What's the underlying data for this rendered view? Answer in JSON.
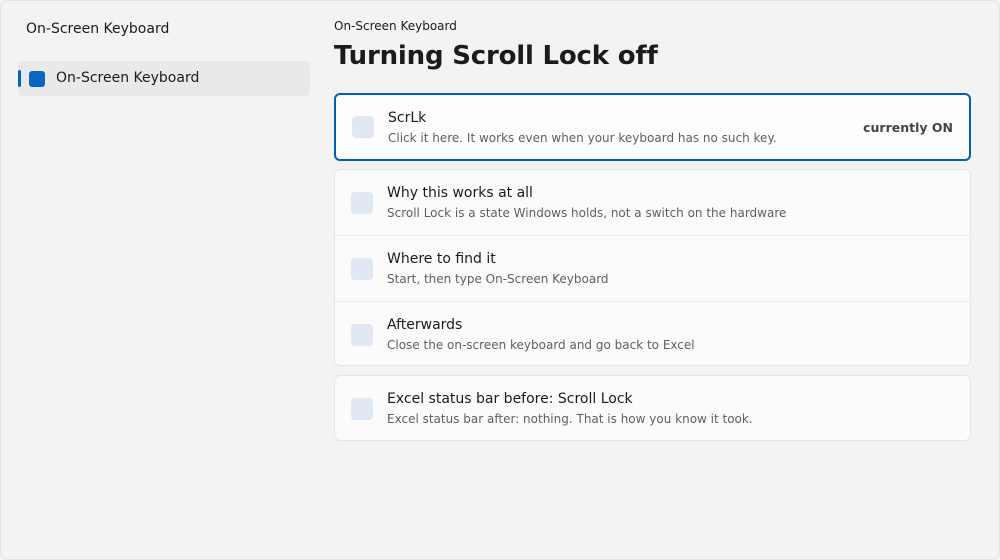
{
  "sidebar": {
    "app_title": "On-Screen Keyboard",
    "items": [
      {
        "label": "On-Screen Keyboard",
        "selected": true,
        "icon": "keyboard-app-icon"
      }
    ]
  },
  "main": {
    "breadcrumb": "On-Screen Keyboard",
    "title": "Turning Scroll Lock off",
    "action_card": {
      "title": "ScrLk",
      "description": "Click it here. It works even when your keyboard has no such key.",
      "status": "currently ON"
    },
    "info_rows": [
      {
        "title": "Why this works at all",
        "description": "Scroll Lock is a state Windows holds, not a switch on the hardware"
      },
      {
        "title": "Where to find it",
        "description": "Start, then type On-Screen Keyboard"
      },
      {
        "title": "Afterwards",
        "description": "Close the on-screen keyboard and go back to Excel"
      }
    ],
    "status_card": {
      "title": "Excel status bar before: Scroll Lock",
      "description": "Excel status bar after: nothing. That is how you know it took."
    }
  },
  "colors": {
    "accent": "#005fb8",
    "background": "#f3f3f3",
    "card": "#fbfbfb"
  }
}
